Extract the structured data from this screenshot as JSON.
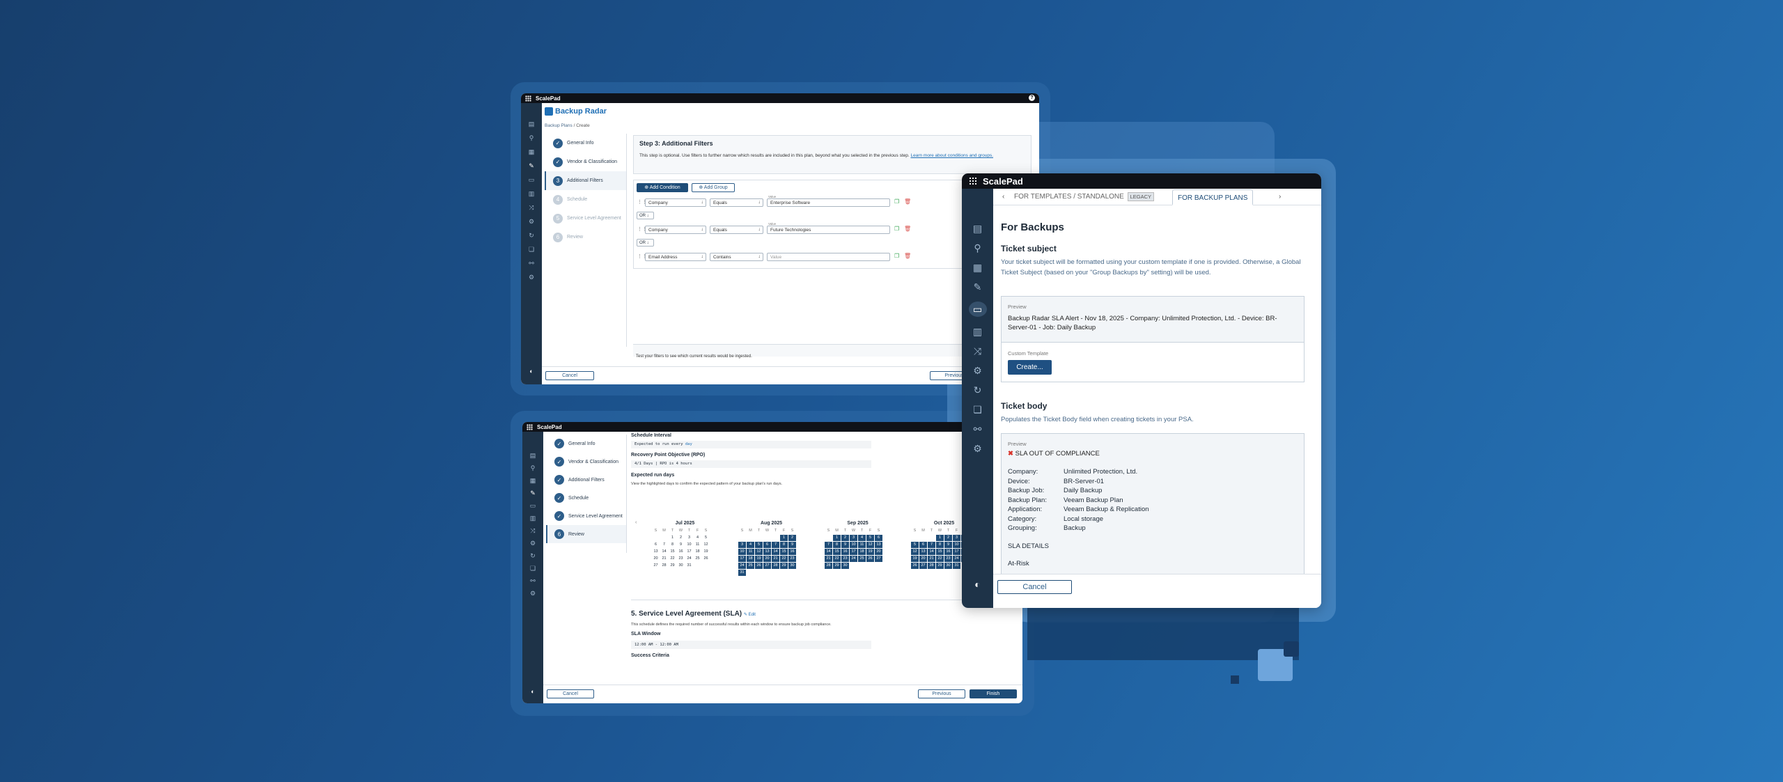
{
  "brand": "ScalePad",
  "product": "Backup Radar",
  "win1": {
    "breadcrumb_1": "Backup Plans",
    "breadcrumb_sep": "/",
    "breadcrumb_2": "Create",
    "steps": [
      {
        "label": "General Info",
        "state": "done"
      },
      {
        "label": "Vendor & Classification",
        "state": "done"
      },
      {
        "label": "Additional Filters",
        "state": "current",
        "num": "3"
      },
      {
        "label": "Schedule",
        "state": "pending",
        "num": "4"
      },
      {
        "label": "Service Level Agreement",
        "state": "pending",
        "num": "5"
      },
      {
        "label": "Review",
        "state": "pending",
        "num": "6"
      }
    ],
    "step_title": "Step 3: Additional Filters",
    "step_desc": "This step is optional. Use filters to further narrow which results are included in this plan, beyond what you selected in the previous step.",
    "learn_more": "Learn more about conditions and groups.",
    "add_condition": "Add Condition",
    "add_group": "Add Group",
    "value_label": "Value",
    "rows": [
      {
        "field": "Company",
        "op": "Equals",
        "value": "Enterprise Software"
      },
      {
        "field": "Company",
        "op": "Equals",
        "value": "Future Technologies"
      },
      {
        "field": "Email Address",
        "op": "Contains",
        "value": "",
        "placeholder": "Value"
      }
    ],
    "or_label": "OR",
    "test_text": "Test your filters to see which current results would be ingested.",
    "cancel": "Cancel",
    "previous": "Previous"
  },
  "win2": {
    "steps": [
      {
        "label": "General Info"
      },
      {
        "label": "Vendor & Classification"
      },
      {
        "label": "Additional Filters"
      },
      {
        "label": "Schedule"
      },
      {
        "label": "Service Level Agreement"
      },
      {
        "label": "Review",
        "num": "6"
      }
    ],
    "schedule_interval_title": "Schedule Interval",
    "schedule_interval_text": "Expected to run every",
    "schedule_interval_link": "day",
    "rpo_title": "Recovery Point Objective (RPO)",
    "rpo_text": "4/1 Days  |  RPO is 4 hours",
    "run_days_title": "Expected run days",
    "run_days_desc": "View the highlighted days to confirm the expected pattern of your backup plan's run days.",
    "weekday_headers": [
      "S",
      "M",
      "T",
      "W",
      "T",
      "F",
      "S"
    ],
    "months": [
      {
        "name": "Jul 2025",
        "lead": 2,
        "days": 31,
        "on": []
      },
      {
        "name": "Aug 2025",
        "lead": 5,
        "days": 31,
        "on": "all"
      },
      {
        "name": "Sep 2025",
        "lead": 1,
        "days": 30,
        "on": "all"
      },
      {
        "name": "Oct 2025",
        "lead": 3,
        "days": 31,
        "on": "all"
      }
    ],
    "sla_title": "5. Service Level Agreement (SLA)",
    "sla_edit": "Edit",
    "sla_desc": "This schedule defines the required number of successful results within each window to ensure backup job compliance.",
    "sla_window_title": "SLA Window",
    "sla_window_value": "12:00 AM - 12:00 AM",
    "success_criteria_title": "Success Criteria",
    "cancel": "Cancel",
    "previous": "Previous",
    "finish": "Finish"
  },
  "win3": {
    "tabs": [
      {
        "label": "FOR TEMPLATES / STANDALONE",
        "badge": "LEGACY"
      },
      {
        "label": "FOR BACKUP PLANS",
        "active": true
      }
    ],
    "heading": "For Backups",
    "subject_title": "Ticket subject",
    "subject_desc": "Your ticket subject will be formatted using your custom template if one is provided. Otherwise, a Global Ticket Subject (based on your \"Group Backups by\" setting) will be used.",
    "preview_label": "Preview",
    "preview_text": "Backup Radar SLA Alert - Nov 18, 2025 - Company: Unlimited Protection, Ltd. - Device: BR-Server-01 - Job: Daily Backup",
    "custom_template_label": "Custom Template",
    "create_button": "Create...",
    "body_title": "Ticket body",
    "body_desc": "Populates the Ticket Body field when creating tickets in your PSA.",
    "body_preview_label": "Preview",
    "sla_status": "SLA OUT OF COMPLIANCE",
    "fields": [
      {
        "k": "Company:",
        "v": "Unlimited Protection, Ltd."
      },
      {
        "k": "Device:",
        "v": "BR-Server-01"
      },
      {
        "k": "Backup Job:",
        "v": "Daily Backup"
      },
      {
        "k": "Backup Plan:",
        "v": "Veeam Backup Plan"
      },
      {
        "k": "Application:",
        "v": "Veeam Backup & Replication"
      },
      {
        "k": "Category:",
        "v": "Local storage"
      },
      {
        "k": "Grouping:",
        "v": "Backup"
      }
    ],
    "sla_details": "SLA DETAILS",
    "at_risk": "At-Risk",
    "cancel": "Cancel"
  },
  "colors": {
    "accent": "#1f4d78",
    "delete": "#d9534f",
    "copy": "#3aa655"
  }
}
